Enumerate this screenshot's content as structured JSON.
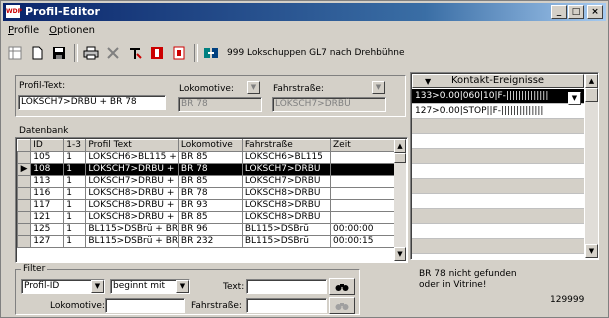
{
  "window": {
    "title": "Profil-Editor",
    "app_icon": "WDP",
    "minimize": "_",
    "maximize": "□",
    "close": "×"
  },
  "menu": {
    "profile": "Profile",
    "profile_u": "P",
    "options": "Optionen",
    "options_u": "O"
  },
  "toolbar": {
    "icons": [
      "grid-icon",
      "new-doc-icon",
      "save-icon",
      "print-icon",
      "delete-icon",
      "text-icon",
      "stop-icon",
      "stop2-icon",
      "refresh-icon"
    ],
    "status_text": "999 Lokschuppen GL7 nach Drehbühne"
  },
  "form": {
    "profiltext_label": "Profil-Text:",
    "profiltext_value": "LOKSCH7>DRBÜ + BR 78",
    "lokomotive_label": "Lokomotive:",
    "lokomotive_value": "BR 78",
    "fahrstrasse_label": "Fahrstraße:",
    "fahrstrasse_value": "LOKSCH7>DRBÜ"
  },
  "database": {
    "label": "Datenbank",
    "columns": [
      "ID",
      "1-3",
      "Profil Text",
      "Lokomotive",
      "Fahrstraße",
      "Zeit"
    ],
    "rows": [
      {
        "id": "105",
        "n": "1",
        "text": "LOKSCH6>BL115 +",
        "lok": "BR 85",
        "fahr": "LOKSCH6>BL115",
        "zeit": "",
        "selected": false,
        "marker": ""
      },
      {
        "id": "108",
        "n": "1",
        "text": "LOKSCH7>DRBÜ +",
        "lok": "BR 78",
        "fahr": "LOKSCH7>DRBÜ",
        "zeit": "",
        "selected": true,
        "marker": "▶"
      },
      {
        "id": "113",
        "n": "1",
        "text": "LOKSCH7>DRBÜ +",
        "lok": "BR 85",
        "fahr": "LOKSCH7>DRBÜ",
        "zeit": "",
        "selected": false,
        "marker": ""
      },
      {
        "id": "116",
        "n": "1",
        "text": "LOKSCH8>DRBÜ +",
        "lok": "BR 78",
        "fahr": "LOKSCH8>DRBÜ",
        "zeit": "",
        "selected": false,
        "marker": ""
      },
      {
        "id": "117",
        "n": "1",
        "text": "LOKSCH8>DRBÜ +",
        "lok": "BR 93",
        "fahr": "LOKSCH8>DRBÜ",
        "zeit": "",
        "selected": false,
        "marker": ""
      },
      {
        "id": "121",
        "n": "1",
        "text": "LOKSCH8>DRBÜ +",
        "lok": "BR 85",
        "fahr": "LOKSCH8>DRBÜ",
        "zeit": "",
        "selected": false,
        "marker": ""
      },
      {
        "id": "125",
        "n": "1",
        "text": "BL115>DSBrü + BR",
        "lok": "BR 96",
        "fahr": "BL115>DSBrü",
        "zeit": "00:00:00",
        "selected": false,
        "marker": ""
      },
      {
        "id": "127",
        "n": "1",
        "text": "BL115>DSBrü + BR",
        "lok": "BR 232",
        "fahr": "BL115>DSBrü",
        "zeit": "00:00:15",
        "selected": false,
        "marker": ""
      }
    ]
  },
  "filter": {
    "label": "Filter",
    "field_select": "Profil-ID",
    "mode_select": "beginnt mit",
    "text_label": "Text:",
    "text_value": "",
    "lok_label": "Lokomotive:",
    "lok_value": "",
    "fahr_label": "Fahrstraße:",
    "fahr_value": ""
  },
  "events": {
    "header": "Kontakt-Ereignisse",
    "rows": [
      {
        "text": "133>0.00|060|10|F-||||||||||||||",
        "style": "selected"
      },
      {
        "text": "127>0.00|STOP||F-||||||||||||||",
        "style": "normal"
      },
      {
        "text": "",
        "style": "gray"
      },
      {
        "text": "",
        "style": "normal"
      },
      {
        "text": "",
        "style": "gray"
      },
      {
        "text": "",
        "style": "normal"
      },
      {
        "text": "",
        "style": "gray"
      },
      {
        "text": "",
        "style": "normal"
      },
      {
        "text": "",
        "style": "gray"
      },
      {
        "text": "",
        "style": "normal"
      },
      {
        "text": "",
        "style": "gray"
      },
      {
        "text": "",
        "style": "normal"
      }
    ]
  },
  "status": {
    "message_line1": "BR 78    nicht gefunden",
    "message_line2": "oder in Vitrine!",
    "number": "129999"
  }
}
